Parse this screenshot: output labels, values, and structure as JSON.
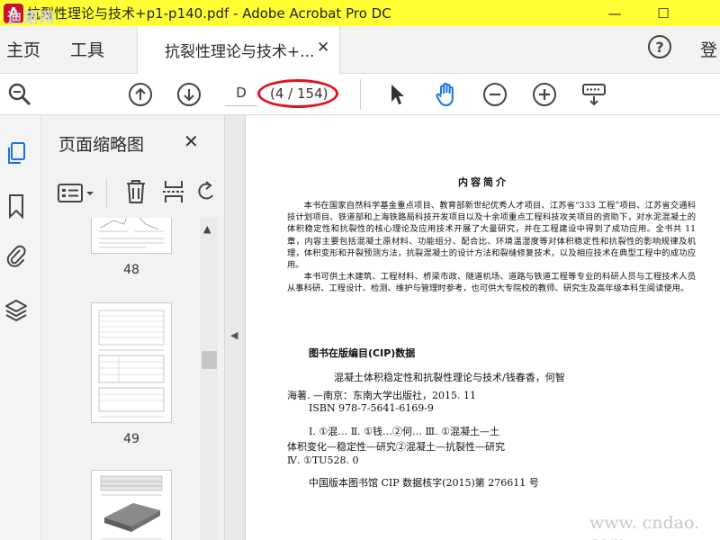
{
  "window": {
    "app_icon": "A",
    "title": "抗裂性理论与技术+p1-p140.pdf - Adobe Acrobat Pro DC",
    "minimize_glyph": "—",
    "maximize_glyph": "☐"
  },
  "nav": {
    "home": "主页",
    "tools": "工具",
    "tab_label": "抗裂性理论与技术+...",
    "tab_close": "✕",
    "help": "?",
    "sign_in": "登"
  },
  "toolbar": {
    "page_value": "D",
    "page_count": "(4 / 154)",
    "highlight_color": "#e0141e"
  },
  "panel": {
    "title": "页面缩略图",
    "close": "✕",
    "thumbnails": [
      {
        "page_label": "48"
      },
      {
        "page_label": "49"
      },
      {
        "page_label": ""
      }
    ]
  },
  "document": {
    "heading": "内容简介",
    "paragraph_1": "本书在国家自然科学基金重点项目、教育部新世纪优秀人才项目、江苏省“333 工程”项目、江苏省交通科技计划项目、铁道部和上海铁路局科技开发项目以及十余项重点工程科技攻关项目的资助下，对水泥混凝土的体积稳定性和抗裂性的核心理论及应用技术开展了大量研究，并在工程建设中得到了成功应用。全书共 11 章，内容主要包括混凝土原材料、功能组分、配合比、环境温湿度等对体积稳定性和抗裂性的影响规律及机理，体积变形和开裂预测方法，抗裂混凝土的设计方法和裂缝修复技术，以及相应技术在典型工程中的成功应用。",
    "paragraph_2": "本书可供土木建筑、工程材料、桥梁市政、隧道机场、道路与铁道工程等专业的科研人员与工程技术人员从事科研、工程设计、检测、维护与管理时参考，也可供大专院校的教师、研究生及高年级本科生阅读使用。",
    "cip_heading": "图书在版编目(CIP)数据",
    "cip_line_1": "混凝土体积稳定性和抗裂性理论与技术/钱春香，何智",
    "cip_line_2": "海著. —南京：东南大学出版社，2015. 11",
    "cip_line_3": "ISBN   978-7-5641-6169-9",
    "cip_line_4": "Ⅰ. ①混…   Ⅱ. ①钱…②何…   Ⅲ. ①混凝土—土",
    "cip_line_5": "体积变化—稳定性—研究②混凝土—抗裂性—研究",
    "cip_line_6": "Ⅳ. ①TU528. 0",
    "cip_line_7": "中国版本图书馆 CIP 数据核字(2015)第 276611 号",
    "watermark": "www. cndao. com",
    "corner_watermark": "迪诺网"
  }
}
